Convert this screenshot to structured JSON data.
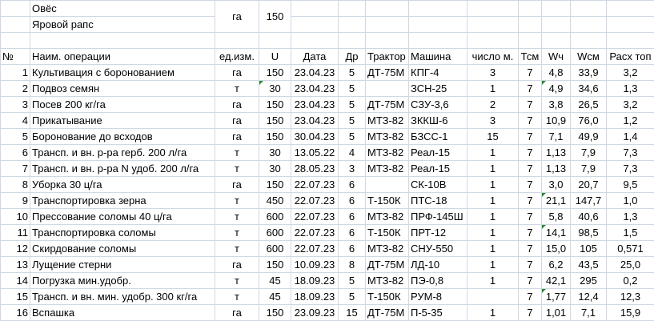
{
  "top_rows": {
    "crop1": "Овёс",
    "crop2": "Яровой рапс",
    "unit": "га",
    "value": "150"
  },
  "headers": [
    "№",
    "Наим. операции",
    "ед.изм.",
    "U",
    "Дата",
    "Др",
    "Трактор",
    "Машина",
    "число м.",
    "Тсм",
    "Wч",
    "Wсм",
    "Расх топ"
  ],
  "rows": [
    [
      "1",
      "Культивация с боронованием",
      "га",
      "150",
      "23.04.23",
      "5",
      "ДТ-75М",
      "КПГ-4",
      "3",
      "7",
      "4,8",
      "33,9",
      "3,2"
    ],
    [
      "2",
      "Подвоз семян",
      "т",
      "30",
      "23.04.23",
      "5",
      "",
      "ЗСН-25",
      "1",
      "7",
      "4,9",
      "34,6",
      "1,3"
    ],
    [
      "3",
      "Посев 200 кг/га",
      "га",
      "150",
      "23.04.23",
      "5",
      "ДТ-75М",
      "СЗУ-3,6",
      "2",
      "7",
      "3,8",
      "26,5",
      "3,2"
    ],
    [
      "4",
      "Прикатывание",
      "га",
      "150",
      "23.04.23",
      "5",
      "МТЗ-82",
      "ЗККШ-6",
      "3",
      "7",
      "10,9",
      "76,0",
      "1,2"
    ],
    [
      "5",
      "Боронование до всходов",
      "га",
      "150",
      "30.04.23",
      "5",
      "МТЗ-82",
      "БЗСС-1",
      "15",
      "7",
      "7,1",
      "49,9",
      "1,4"
    ],
    [
      "6",
      "Трансп. и вн. р-ра герб. 200 л/га",
      "т",
      "30",
      "13.05.22",
      "4",
      "МТЗ-82",
      "Реал-15",
      "1",
      "7",
      "1,13",
      "7,9",
      "7,3"
    ],
    [
      "7",
      "Трансп. и вн. р-ра N удоб. 200 л/га",
      "т",
      "30",
      "28.05.23",
      "3",
      "МТЗ-82",
      "Реал-15",
      "1",
      "7",
      "1,13",
      "7,9",
      "7,3"
    ],
    [
      "8",
      "Уборка 30 ц/га",
      "га",
      "150",
      "22.07.23",
      "6",
      "",
      "СК-10В",
      "1",
      "7",
      "3,0",
      "20,7",
      "9,5"
    ],
    [
      "9",
      "Транспортировка зерна",
      "т",
      "450",
      "22.07.23",
      "6",
      "Т-150К",
      "ПТС-18",
      "1",
      "7",
      "21,1",
      "147,7",
      "1,0"
    ],
    [
      "10",
      "Прессование соломы 40 ц/га",
      "т",
      "600",
      "22.07.23",
      "6",
      "МТЗ-82",
      "ПРФ-145Ш",
      "1",
      "7",
      "5,8",
      "40,6",
      "1,3"
    ],
    [
      "11",
      "Транспортировка соломы",
      "т",
      "600",
      "22.07.23",
      "6",
      "Т-150К",
      "ПРТ-12",
      "1",
      "7",
      "14,1",
      "98,5",
      "1,5"
    ],
    [
      "12",
      "Скирдование соломы",
      "т",
      "600",
      "22.07.23",
      "6",
      "МТЗ-82",
      "СНУ-550",
      "1",
      "7",
      "15,0",
      "105",
      "0,571"
    ],
    [
      "13",
      "Лущение стерни",
      "га",
      "150",
      "10.09.23",
      "8",
      "ДТ-75М",
      "ЛД-10",
      "1",
      "7",
      "6,2",
      "43,5",
      "25,0"
    ],
    [
      "14",
      "Погрузка мин.удобр.",
      "т",
      "45",
      "18.09.23",
      "5",
      "МТЗ-82",
      "ПЭ-0,8",
      "1",
      "7",
      "42,1",
      "295",
      "0,2"
    ],
    [
      "15",
      "Трансп. и вн. мин. удобр. 300 кг/га",
      "т",
      "45",
      "18.09.23",
      "5",
      "Т-150К",
      "РУМ-8",
      "",
      "7",
      "1,77",
      "12,4",
      "12,3"
    ],
    [
      "16",
      "Вспашка",
      "га",
      "150",
      "23.09.23",
      "15",
      "ДТ-75М",
      "П-5-35",
      "1",
      "7",
      "1,01",
      "7,1",
      "15,9"
    ]
  ],
  "colors": {
    "gridline": "#d0d7e5",
    "comment_marker": "#2e8b2e"
  }
}
